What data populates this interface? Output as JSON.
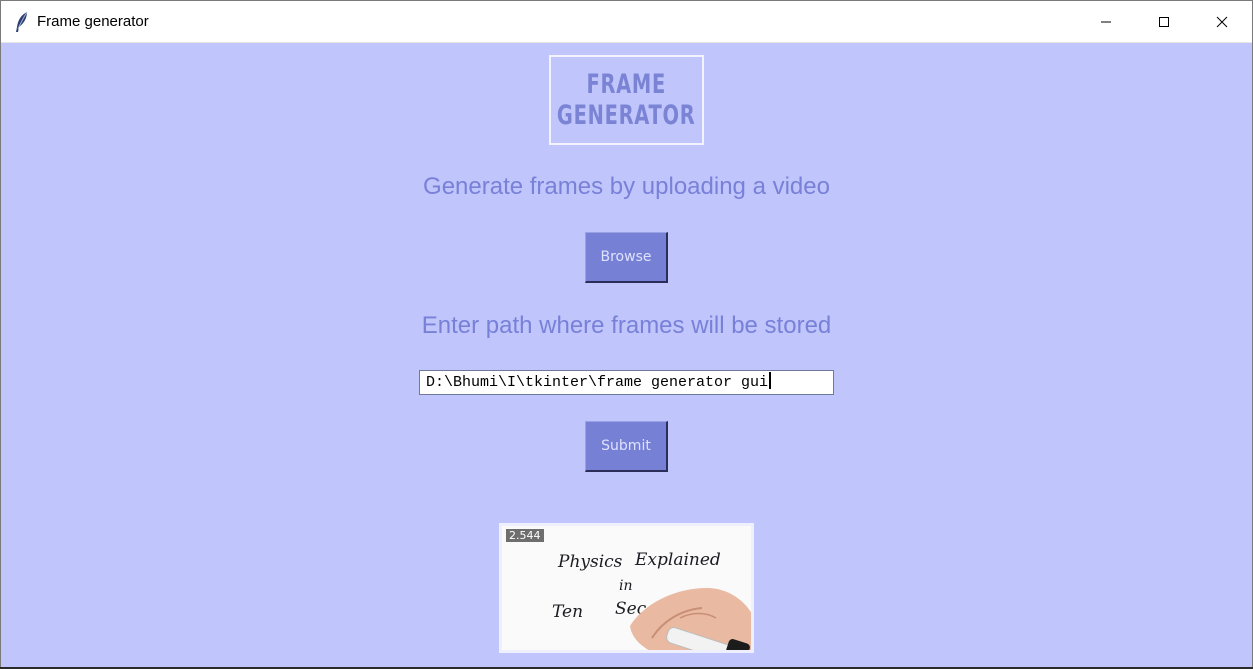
{
  "window": {
    "title": "Frame generator"
  },
  "logo": {
    "line1": "FRAME",
    "line2": "GENERATOR"
  },
  "upload": {
    "heading": "Generate frames by uploading a video",
    "browse_label": "Browse"
  },
  "output": {
    "heading": "Enter path where frames will be stored",
    "path_value": "D:\\Bhumi\\I\\tkinter\\frame generator gui",
    "submit_label": "Submit"
  },
  "preview": {
    "timestamp": "2.544",
    "line1_word1": "Physics",
    "line1_word2": "Explained",
    "line2": "in",
    "line3_word1": "Ten",
    "line3_word2": "Sec"
  },
  "colors": {
    "background": "#c0c6fb",
    "accent": "#7680d5",
    "heading_text": "#7880d8",
    "button_text": "#dfe2ff"
  },
  "icons": {
    "app": "feather-icon",
    "minimize": "minimize-icon",
    "maximize": "maximize-icon",
    "close": "close-icon"
  }
}
